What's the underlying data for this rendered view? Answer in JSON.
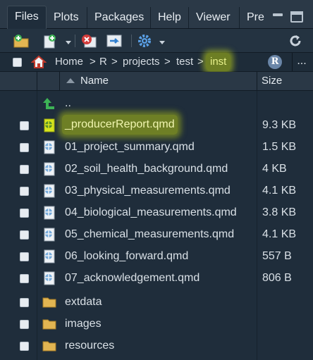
{
  "tabs": [
    {
      "label": "Files",
      "active": true
    },
    {
      "label": "Plots",
      "active": false
    },
    {
      "label": "Packages",
      "active": false
    },
    {
      "label": "Help",
      "active": false
    },
    {
      "label": "Viewer",
      "active": false
    },
    {
      "label": "Pre",
      "active": false
    }
  ],
  "toolbar": {
    "buttons": [
      "new-folder-icon",
      "new-file-icon",
      "delete-icon",
      "rename-icon",
      "gear-icon"
    ]
  },
  "breadcrumb": {
    "items": [
      "Home",
      "R",
      "projects",
      "test",
      "inst"
    ],
    "separator": ">",
    "highlighted": "inst",
    "project_badge": "R",
    "more": "..."
  },
  "columns": {
    "name": "Name",
    "size": "Size"
  },
  "parent_dir": "..",
  "files": [
    {
      "name": "_producerReport.qmd",
      "size": "9.3 KB",
      "type": "quarto-file",
      "highlighted": true
    },
    {
      "name": "01_project_summary.qmd",
      "size": "1.5 KB",
      "type": "quarto-file",
      "highlighted": false
    },
    {
      "name": "02_soil_health_background.qmd",
      "size": "4 KB",
      "type": "quarto-file",
      "highlighted": false
    },
    {
      "name": "03_physical_measurements.qmd",
      "size": "4.1 KB",
      "type": "quarto-file",
      "highlighted": false
    },
    {
      "name": "04_biological_measurements.qmd",
      "size": "3.8 KB",
      "type": "quarto-file",
      "highlighted": false
    },
    {
      "name": "05_chemical_measurements.qmd",
      "size": "4.1 KB",
      "type": "quarto-file",
      "highlighted": false
    },
    {
      "name": "06_looking_forward.qmd",
      "size": "557 B",
      "type": "quarto-file",
      "highlighted": false
    },
    {
      "name": "07_acknowledgement.qmd",
      "size": "806 B",
      "type": "quarto-file",
      "highlighted": false
    },
    {
      "name": "extdata",
      "size": "",
      "type": "folder",
      "highlighted": false
    },
    {
      "name": "images",
      "size": "",
      "type": "folder",
      "highlighted": false
    },
    {
      "name": "resources",
      "size": "",
      "type": "folder",
      "highlighted": false
    }
  ],
  "colors": {
    "highlight": "#d7e51d",
    "background": "#1f2d3b",
    "folder": "#e2b552",
    "quarto_icon": "#75aadb",
    "up_arrow": "#3db356"
  }
}
